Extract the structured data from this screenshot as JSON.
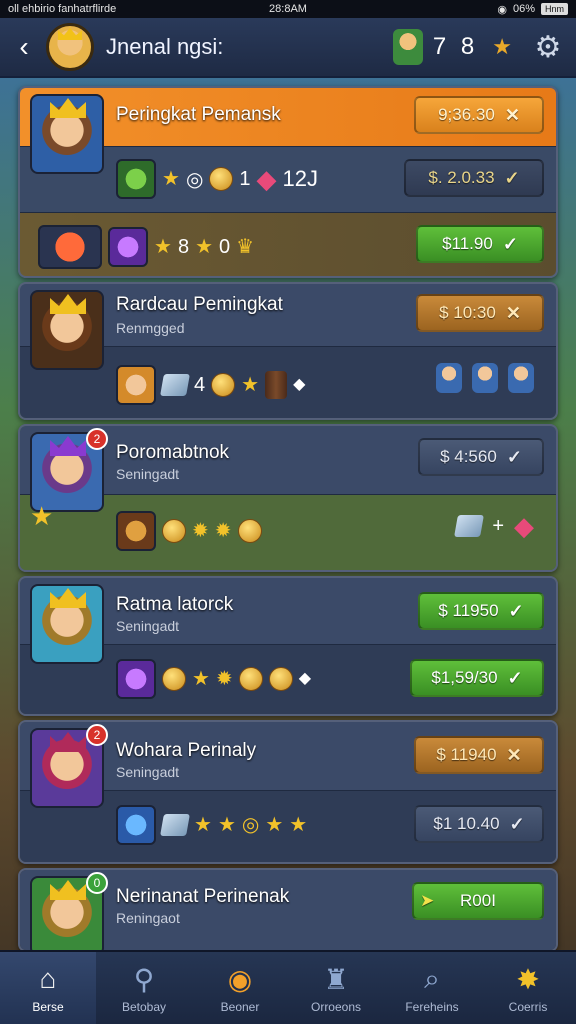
{
  "status": {
    "left": "oll ehbirio fanhatrflirde",
    "time": "28:8AM",
    "battery": "06%",
    "right_extra": "Hnm"
  },
  "header": {
    "title": "Jnenal ngsi:",
    "count": "7 8"
  },
  "cards": [
    {
      "title": "Peringkat Pemansk",
      "price1": "9;36.30",
      "price1_icon": "✕",
      "mid_text": "1",
      "mid_num": "12J",
      "price2": "$. 2.0.33",
      "price2_icon": "✓",
      "bot_text": "8",
      "bot_text2": "0",
      "price3": "$11.90",
      "price3_icon": "✓"
    },
    {
      "title": "Rardcau Pemingkat",
      "sub": "Renmgged",
      "price1": "$ 10:30",
      "price1_icon": "✕",
      "mid_text": "4"
    },
    {
      "title": "Poromabtnok",
      "sub": "Seningadt",
      "price1": "$ 4:560",
      "price1_icon": "✓",
      "badge": "2",
      "plus": "+"
    },
    {
      "title": "Ratma latorck",
      "sub": "Seningadt",
      "price1": "$ 11950",
      "price1_icon": "✓",
      "price2": "$1,59/30",
      "price2_icon": "✓"
    },
    {
      "title": "Wohara Perinaly",
      "sub": "Seningadt",
      "price1": "$ 11940",
      "price1_icon": "✕",
      "price2": "$1 10.40",
      "price2_icon": "✓",
      "badge": "2"
    },
    {
      "title": "Nerinanat Perinenak",
      "sub": "Reningaot",
      "price1": "R00I",
      "badge": "0"
    }
  ],
  "nav": [
    {
      "label": "Berse"
    },
    {
      "label": "Betobay"
    },
    {
      "label": "Beoner"
    },
    {
      "label": "Orroeons"
    },
    {
      "label": "Fereheins"
    },
    {
      "label": "Coerris"
    }
  ],
  "colors": {
    "accent_orange": "#e77a18",
    "accent_green": "#3a8f24",
    "bg_panel": "#2f3c56"
  }
}
